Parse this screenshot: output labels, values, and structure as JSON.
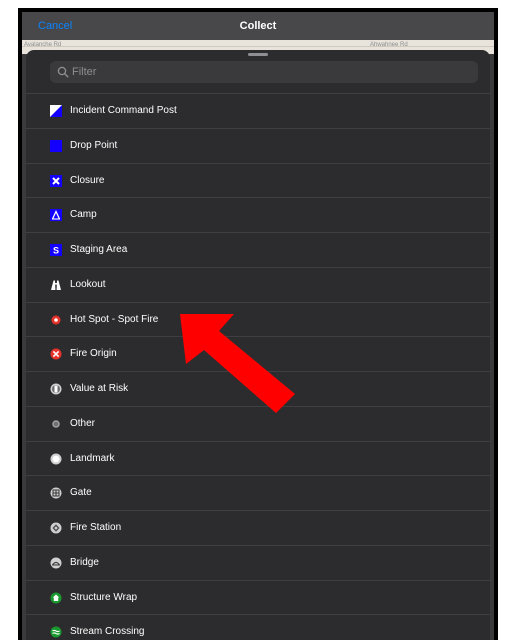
{
  "navbar": {
    "cancel_label": "Cancel",
    "title": "Collect"
  },
  "map_labels": [
    "Avalanche Rd",
    "Ahwahnee Rd"
  ],
  "search": {
    "placeholder": "Filter"
  },
  "items": [
    {
      "label": "Incident Command Post",
      "icon": "incident-command-post-icon"
    },
    {
      "label": "Drop Point",
      "icon": "drop-point-icon"
    },
    {
      "label": "Closure",
      "icon": "closure-icon"
    },
    {
      "label": "Camp",
      "icon": "camp-icon"
    },
    {
      "label": "Staging Area",
      "icon": "staging-area-icon"
    },
    {
      "label": "Lookout",
      "icon": "lookout-icon"
    },
    {
      "label": "Hot Spot - Spot Fire",
      "icon": "hot-spot-icon"
    },
    {
      "label": "Fire Origin",
      "icon": "fire-origin-icon"
    },
    {
      "label": "Value at Risk",
      "icon": "value-at-risk-icon"
    },
    {
      "label": "Other",
      "icon": "other-icon"
    },
    {
      "label": "Landmark",
      "icon": "landmark-icon"
    },
    {
      "label": "Gate",
      "icon": "gate-icon"
    },
    {
      "label": "Fire Station",
      "icon": "fire-station-icon"
    },
    {
      "label": "Bridge",
      "icon": "bridge-icon"
    },
    {
      "label": "Structure Wrap",
      "icon": "structure-wrap-icon"
    },
    {
      "label": "Stream Crossing",
      "icon": "stream-crossing-icon"
    }
  ],
  "colors": {
    "accent": "#0a84ff",
    "annotation_arrow": "#ff0000",
    "icon_blue": "#1400ff",
    "icon_red": "#e8312a",
    "icon_green": "#1a9a2e"
  }
}
